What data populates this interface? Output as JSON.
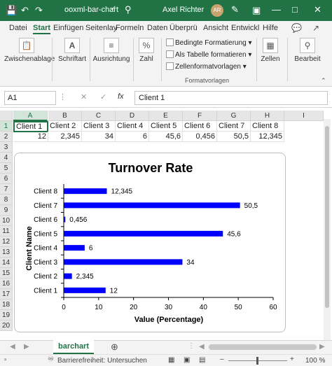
{
  "app": {
    "title": "ooxml-bar-chart",
    "user": "Axel Richter",
    "user_initials": "AR",
    "accent": "#217346"
  },
  "tabs": [
    "Datei",
    "Start",
    "Einfügen",
    "Seitenlay",
    "Formeln",
    "Daten",
    "Überprü",
    "Ansicht",
    "Entwickl",
    "Hilfe"
  ],
  "ribbon": {
    "paste": "Zwischenablage",
    "font": "Schriftart",
    "alignment": "Ausrichtung",
    "number": "Zahl",
    "number_symbol": "%",
    "cond_format": "Bedingte Formatierung",
    "table_format": "Als Tabelle formatieren",
    "cell_styles": "Zellenformatvorlagen",
    "styles_group": "Formatvorlagen",
    "cells": "Zellen",
    "edit": "Bearbeit"
  },
  "formula": {
    "name_box": "A1",
    "fx": "fx",
    "value": "Client 1"
  },
  "columns": [
    "A",
    "B",
    "C",
    "D",
    "E",
    "F",
    "G",
    "H",
    "I"
  ],
  "rows": [
    "1",
    "2",
    "3",
    "4",
    "5",
    "6",
    "7",
    "8",
    "9",
    "10",
    "11",
    "12",
    "13",
    "14",
    "15",
    "16",
    "17",
    "18",
    "19",
    "20"
  ],
  "sheet": {
    "row1": [
      "Client 1",
      "Client 2",
      "Client 3",
      "Client 4",
      "Client 5",
      "Client 6",
      "Client 7",
      "Client 8"
    ],
    "row2": [
      "12",
      "2,345",
      "34",
      "6",
      "45,6",
      "0,456",
      "50,5",
      "12,345"
    ]
  },
  "chart_data": {
    "type": "bar",
    "orientation": "horizontal",
    "title": "Turnover Rate",
    "xlabel": "Value (Percentage)",
    "ylabel": "Client Name",
    "categories": [
      "Client 1",
      "Client 2",
      "Client 3",
      "Client 4",
      "Client 5",
      "Client 6",
      "Client 7",
      "Client 8"
    ],
    "values": [
      12,
      2.345,
      34,
      6,
      45.6,
      0.456,
      50.5,
      12.345
    ],
    "value_labels": [
      "12",
      "2,345",
      "34",
      "6",
      "45,6",
      "0,456",
      "50,5",
      "12,345"
    ],
    "xlim": [
      0,
      60
    ],
    "xticks": [
      "0",
      "10",
      "20",
      "30",
      "40",
      "50",
      "60"
    ],
    "grid": false,
    "legend": "none",
    "bar_color": "#0000ff"
  },
  "sheet_tab": "barchart",
  "status": {
    "accessibility": "Barrierefreiheit: Untersuchen",
    "zoom": "100 %"
  }
}
